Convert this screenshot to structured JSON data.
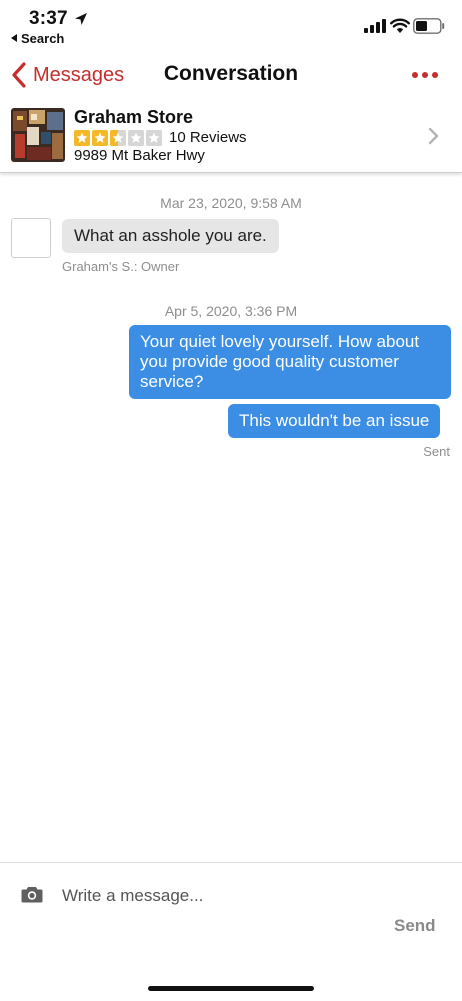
{
  "status_bar": {
    "time": "3:37",
    "back_app": "Search"
  },
  "nav": {
    "back_label": "Messages",
    "title": "Conversation",
    "accent_color": "#c62e2e"
  },
  "business": {
    "name": "Graham Store",
    "rating": 2.5,
    "rating_max": 5,
    "reviews": "10 Reviews",
    "address": "9989 Mt Baker Hwy",
    "star_color": "#f3b928"
  },
  "messages": {
    "date1": "Mar 23, 2020, 9:58 AM",
    "incoming_text": "What an asshole you are.",
    "sender_label": "Graham's S.: Owner",
    "date2": "Apr 5, 2020, 3:36 PM",
    "outgoing_1": "Your quiet lovely yourself. How about you provide good quality customer service?",
    "outgoing_2": "This wouldn't be an issue",
    "sent_label": "Sent",
    "outgoing_color": "#3b8ee3"
  },
  "composer": {
    "placeholder": "Write a message...",
    "send_label": "Send"
  }
}
